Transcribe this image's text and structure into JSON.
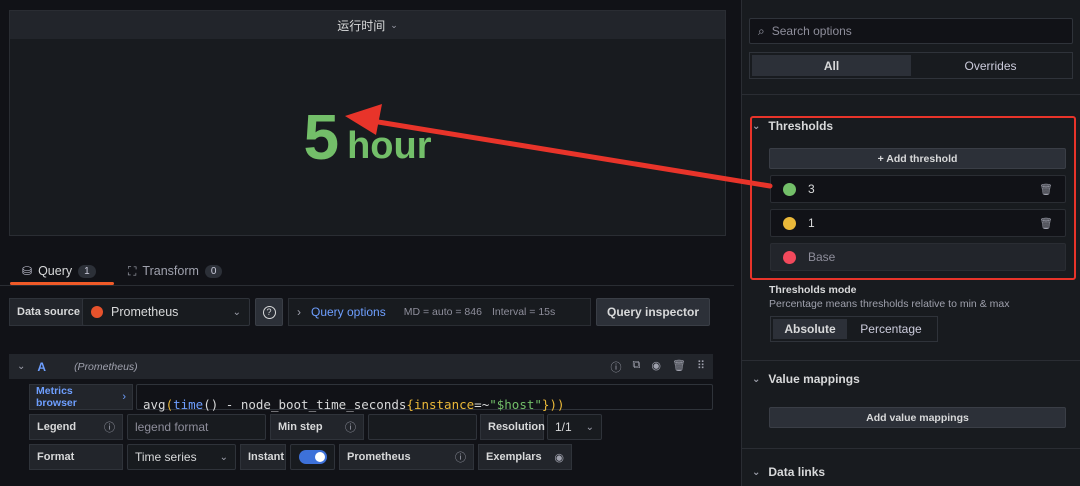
{
  "panel": {
    "title": "运行时间",
    "value": "5",
    "unit": "hour",
    "value_color": "#73bf69"
  },
  "tabs": [
    {
      "label": "Query",
      "count": "1"
    },
    {
      "label": "Transform",
      "count": "0"
    }
  ],
  "query_row": {
    "datasource_label": "Data source",
    "datasource": "Prometheus",
    "query_options": "Query options",
    "md": "MD = auto = 846",
    "interval": "Interval = 15s",
    "inspector": "Query inspector"
  },
  "query": {
    "ref": "A",
    "datasource_hint": "(Prometheus)",
    "metrics_browser": "Metrics browser",
    "expr": {
      "fn": "avg",
      "p1": "(",
      "time": "time",
      "p2": "() - node_boot_time_seconds",
      "b1": "{",
      "key": "instance",
      "op": "=~",
      "str": "\"$host\"",
      "b2": "}",
      "p3": "))"
    },
    "legend_label": "Legend",
    "legend_placeholder": "legend format",
    "minstep_label": "Min step",
    "resolution_label": "Resolution",
    "resolution_value": "1/1",
    "format_label": "Format",
    "format_value": "Time series",
    "instant_label": "Instant",
    "prometheus_label": "Prometheus",
    "exemplars_label": "Exemplars"
  },
  "options": {
    "search_placeholder": "Search options",
    "tab_all": "All",
    "tab_overrides": "Overrides"
  },
  "thresholds": {
    "title": "Thresholds",
    "add": "+ Add threshold",
    "items": [
      {
        "value": "3",
        "color": "#73bf69"
      },
      {
        "value": "1",
        "color": "#eab839"
      },
      {
        "value": "Base",
        "color": "#f2495c"
      }
    ],
    "mode_title": "Thresholds mode",
    "mode_desc": "Percentage means thresholds relative to min & max",
    "mode_absolute": "Absolute",
    "mode_percentage": "Percentage"
  },
  "value_mappings": {
    "title": "Value mappings",
    "add": "Add value mappings"
  },
  "data_links": {
    "title": "Data links"
  },
  "annotation_color": "#e8342a"
}
